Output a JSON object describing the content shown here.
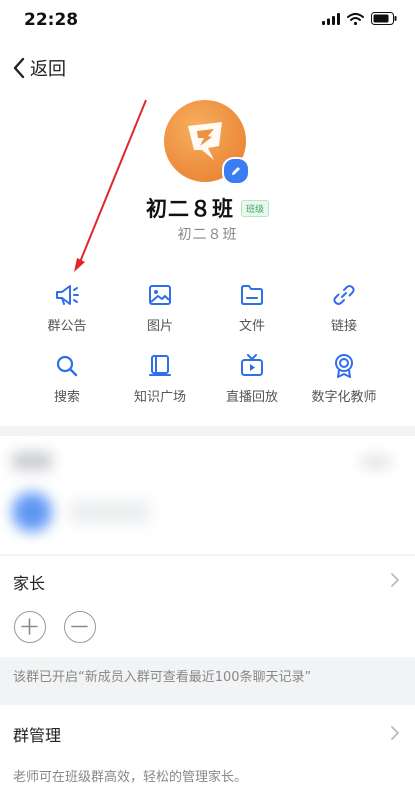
{
  "status_bar": {
    "time": "22:28"
  },
  "nav": {
    "back_label": "返回"
  },
  "group": {
    "name": "初二８班",
    "badge": "班级",
    "subtitle": "初二８班"
  },
  "functions": [
    {
      "label": "群公告",
      "icon": "megaphone-icon"
    },
    {
      "label": "图片",
      "icon": "image-icon"
    },
    {
      "label": "文件",
      "icon": "folder-icon"
    },
    {
      "label": "链接",
      "icon": "link-icon"
    },
    {
      "label": "搜索",
      "icon": "search-icon"
    },
    {
      "label": "知识广场",
      "icon": "book-icon"
    },
    {
      "label": "直播回放",
      "icon": "tv-play-icon"
    },
    {
      "label": "数字化教师",
      "icon": "badge-icon"
    }
  ],
  "parents": {
    "title": "家长"
  },
  "notice": {
    "text": "该群已开启“新成员入群可查看最近100条聊天记录”"
  },
  "management": {
    "title": "群管理",
    "description": "老师可在班级群高效，轻松的管理家长。"
  },
  "colors": {
    "accent": "#3a7cf1",
    "icon_blue": "#2f6fea",
    "avatar_orange": "#ee9140",
    "arrow_red": "#e0282a"
  }
}
